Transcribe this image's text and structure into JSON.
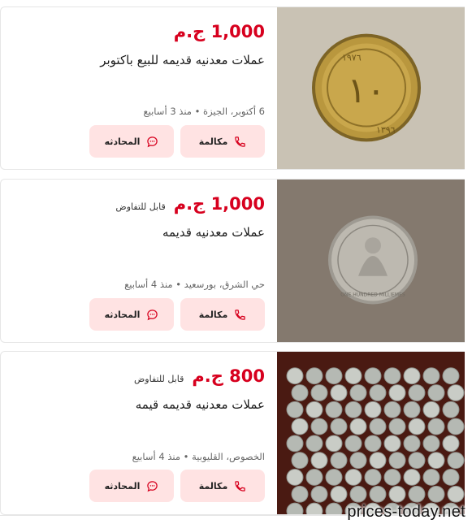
{
  "listings": [
    {
      "price": "1,000 ج.م",
      "negotiable": "",
      "title": "عملات معدنيه قديمه للبيع باكتوبر",
      "meta": "6 أكتوبر، الجيزة • منذ 3 أسابيع",
      "call_label": "مكالمة",
      "chat_label": "المحادثه",
      "image": "coin-gold-image"
    },
    {
      "price": "1,000 ج.م",
      "negotiable": "قابل للتفاوض",
      "title": "عملات معدنيه قديمه",
      "meta": "حي الشرق، بورسعيد • منذ 4 أسابيع",
      "call_label": "مكالمة",
      "chat_label": "المحادثه",
      "image": "coin-silver-image"
    },
    {
      "price": "800 ج.م",
      "negotiable": "قابل للتفاوض",
      "title": "عملات معدنيه قديمه قيمه",
      "meta": "الخصوص، القليوبية • منذ 4 أسابيع",
      "call_label": "مكالمة",
      "chat_label": "المحادثه",
      "image": "coins-many-image"
    }
  ],
  "watermark": "prices-today.net",
  "colors": {
    "price": "#d7001e",
    "button_bg": "#ffe3e3",
    "icon": "#d7001e"
  },
  "icons": {
    "call": "phone-icon",
    "chat": "chat-bubble-icon"
  }
}
